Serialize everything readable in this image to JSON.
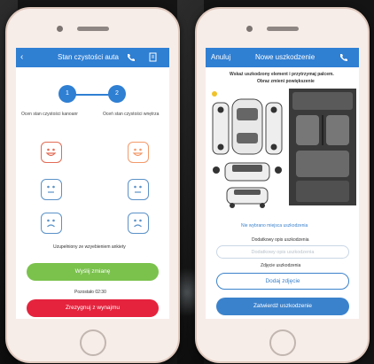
{
  "left_screen": {
    "header": {
      "back_icon": "chevron-left-icon",
      "title": "Stan czystości auta",
      "phone_icon": "phone-icon",
      "doc_icon": "document-icon"
    },
    "steps": [
      {
        "number": "1"
      },
      {
        "number": "2"
      }
    ],
    "columns": [
      "Ocen stan czystości kanoanr",
      "Oceń stan czystości wnętrza"
    ],
    "rating_rows": [
      "happy",
      "neutral",
      "sad"
    ],
    "status_text": "Uzupełniony ze wzyebieniem ankiety",
    "primary_button": "Wyślij zmianę",
    "time_text": "Pozostało 02:30",
    "secondary_button": "Zrezygnuj z wynajmu"
  },
  "right_screen": {
    "header": {
      "back_label": "Anuluj",
      "title": "Nowe uszkodzenie",
      "phone_icon": "phone-icon"
    },
    "instruction_line1": "Wskaż uszkodzony element i przytrzymaj palcem.",
    "instruction_line2": "Obraz zmieni powiększenie",
    "link_text": "Nie wybrano miejsca uszkodzenia",
    "description_label": "Dodatkowy opis uszkodzenia",
    "description_placeholder": "Dodatkowy opis uszkodzenia",
    "photo_label": "Zdjęcie uszkodzenia",
    "photo_button": "Dodaj zdjęcie",
    "confirm_button": "Zatwierdź uszkodzenie"
  },
  "colors": {
    "primary": "#2f7fd3",
    "green": "#7bc24d",
    "red": "#e5233d",
    "happy": "#e26b55",
    "neutral": "#5b92c8"
  }
}
